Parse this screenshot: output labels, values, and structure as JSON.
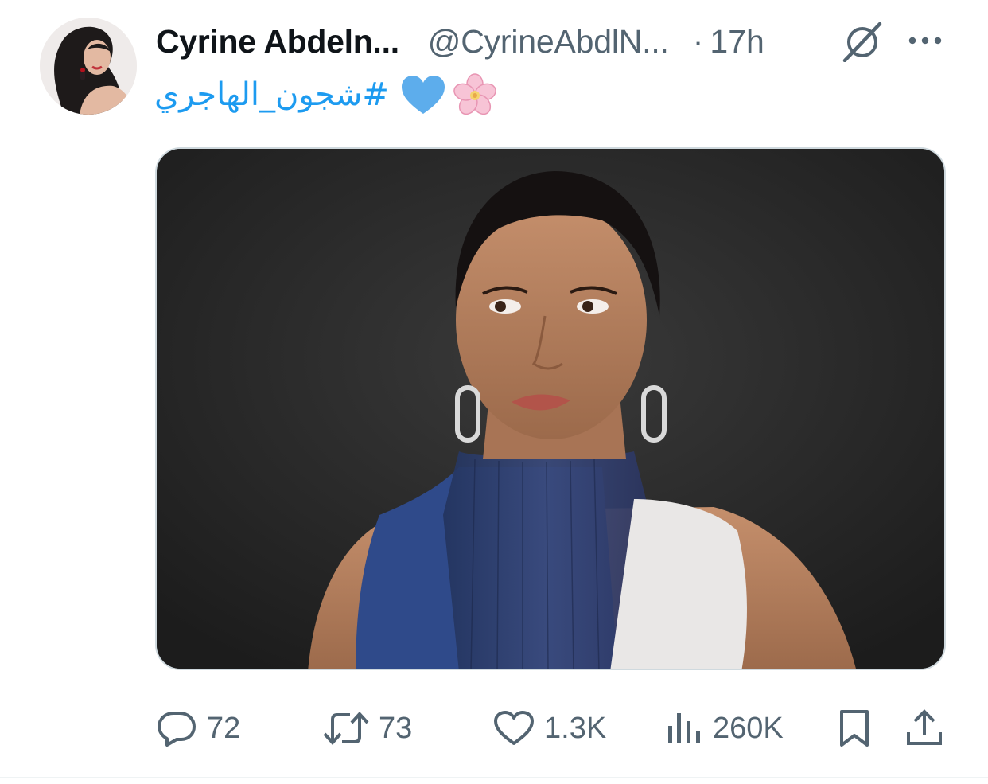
{
  "tweet": {
    "author": {
      "display_name": "Cyrine Abdeln...",
      "handle": "@CyrineAbdlN...",
      "avatar_icon": "profile-photo"
    },
    "separator": "·",
    "time": "17h",
    "text": {
      "hashtag": "#شجون_الهاجري",
      "emojis": [
        "blue-heart",
        "cherry-blossom"
      ]
    },
    "media": {
      "type": "photo",
      "icon": "portrait-photo"
    },
    "actions": {
      "reply": {
        "icon": "reply-icon",
        "count": "72"
      },
      "retweet": {
        "icon": "retweet-icon",
        "count": "73"
      },
      "like": {
        "icon": "heart-icon",
        "count": "1.3K"
      },
      "views": {
        "icon": "views-icon",
        "count": "260K"
      },
      "bookmark": {
        "icon": "bookmark-icon"
      },
      "share": {
        "icon": "share-icon"
      }
    },
    "header_icons": [
      "grok-icon",
      "more-icon"
    ]
  },
  "colors": {
    "link": "#1d9bf0",
    "secondary_text": "#536471",
    "primary_text": "#0f1419",
    "border": "#cfd9de"
  }
}
